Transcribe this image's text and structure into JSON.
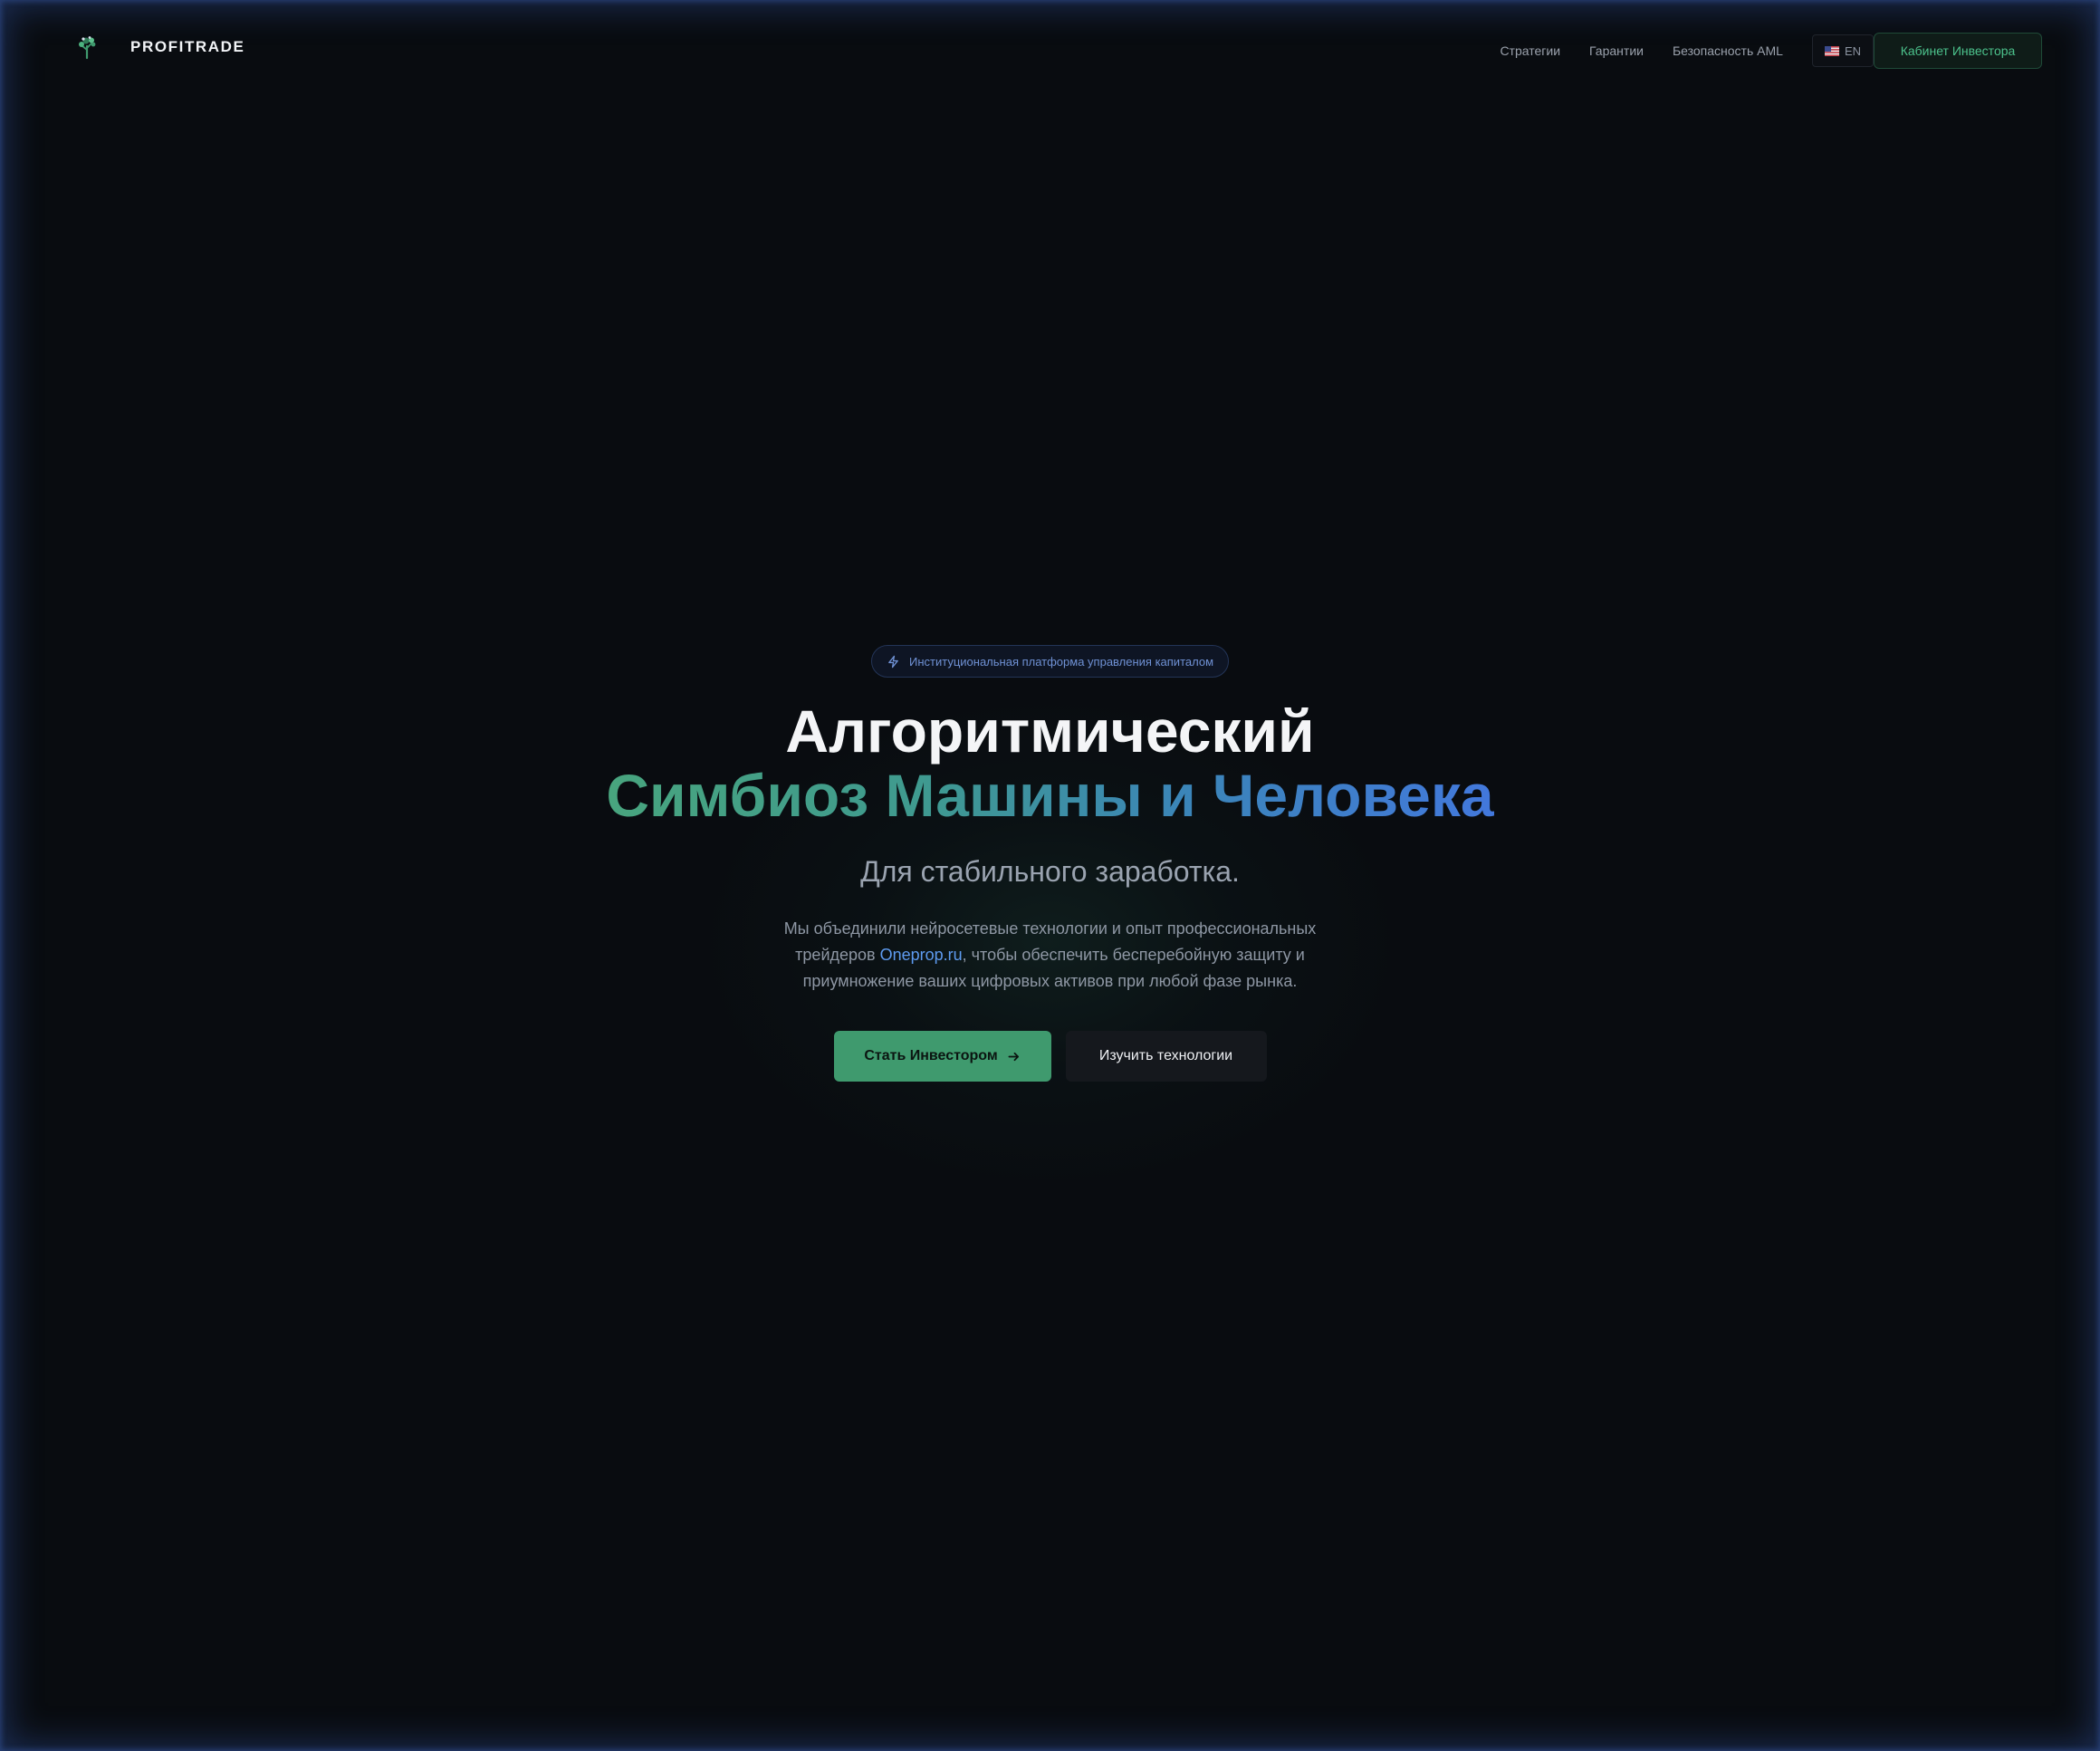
{
  "header": {
    "brand": "PROFITRADE",
    "logo_icon": "tree-logo-icon",
    "nav": [
      {
        "label": "Стратегии"
      },
      {
        "label": "Гарантии"
      },
      {
        "label": "Безопасность AML"
      }
    ],
    "language": {
      "label": "EN",
      "flag_icon": "us-flag-icon"
    },
    "cabinet_label": "Кабинет Инвестора"
  },
  "hero": {
    "badge": {
      "icon": "lightning-icon",
      "label": "Институциональная платформа управления капиталом"
    },
    "title_line1": "Алгоритмический",
    "title_line2": "Симбиоз Машины и Человека",
    "subtitle": "Для стабильного заработка.",
    "description": {
      "before": "Мы объединили нейросетевые технологии и опыт профессиональных трейдеров ",
      "link": "Oneprop.ru",
      "after": ", чтобы обеспечить бесперебойную защиту и приумножение ваших цифровых активов при любой фазе рынка."
    },
    "primary_button": {
      "label": "Стать Инвестором",
      "icon": "arrow-right-icon"
    },
    "secondary_button": {
      "label": "Изучить технологии"
    }
  },
  "colors": {
    "background": "#090c10",
    "accent_green": "#3f9a6e",
    "accent_blue": "#4278dc",
    "link_blue": "#5e9bf0"
  }
}
